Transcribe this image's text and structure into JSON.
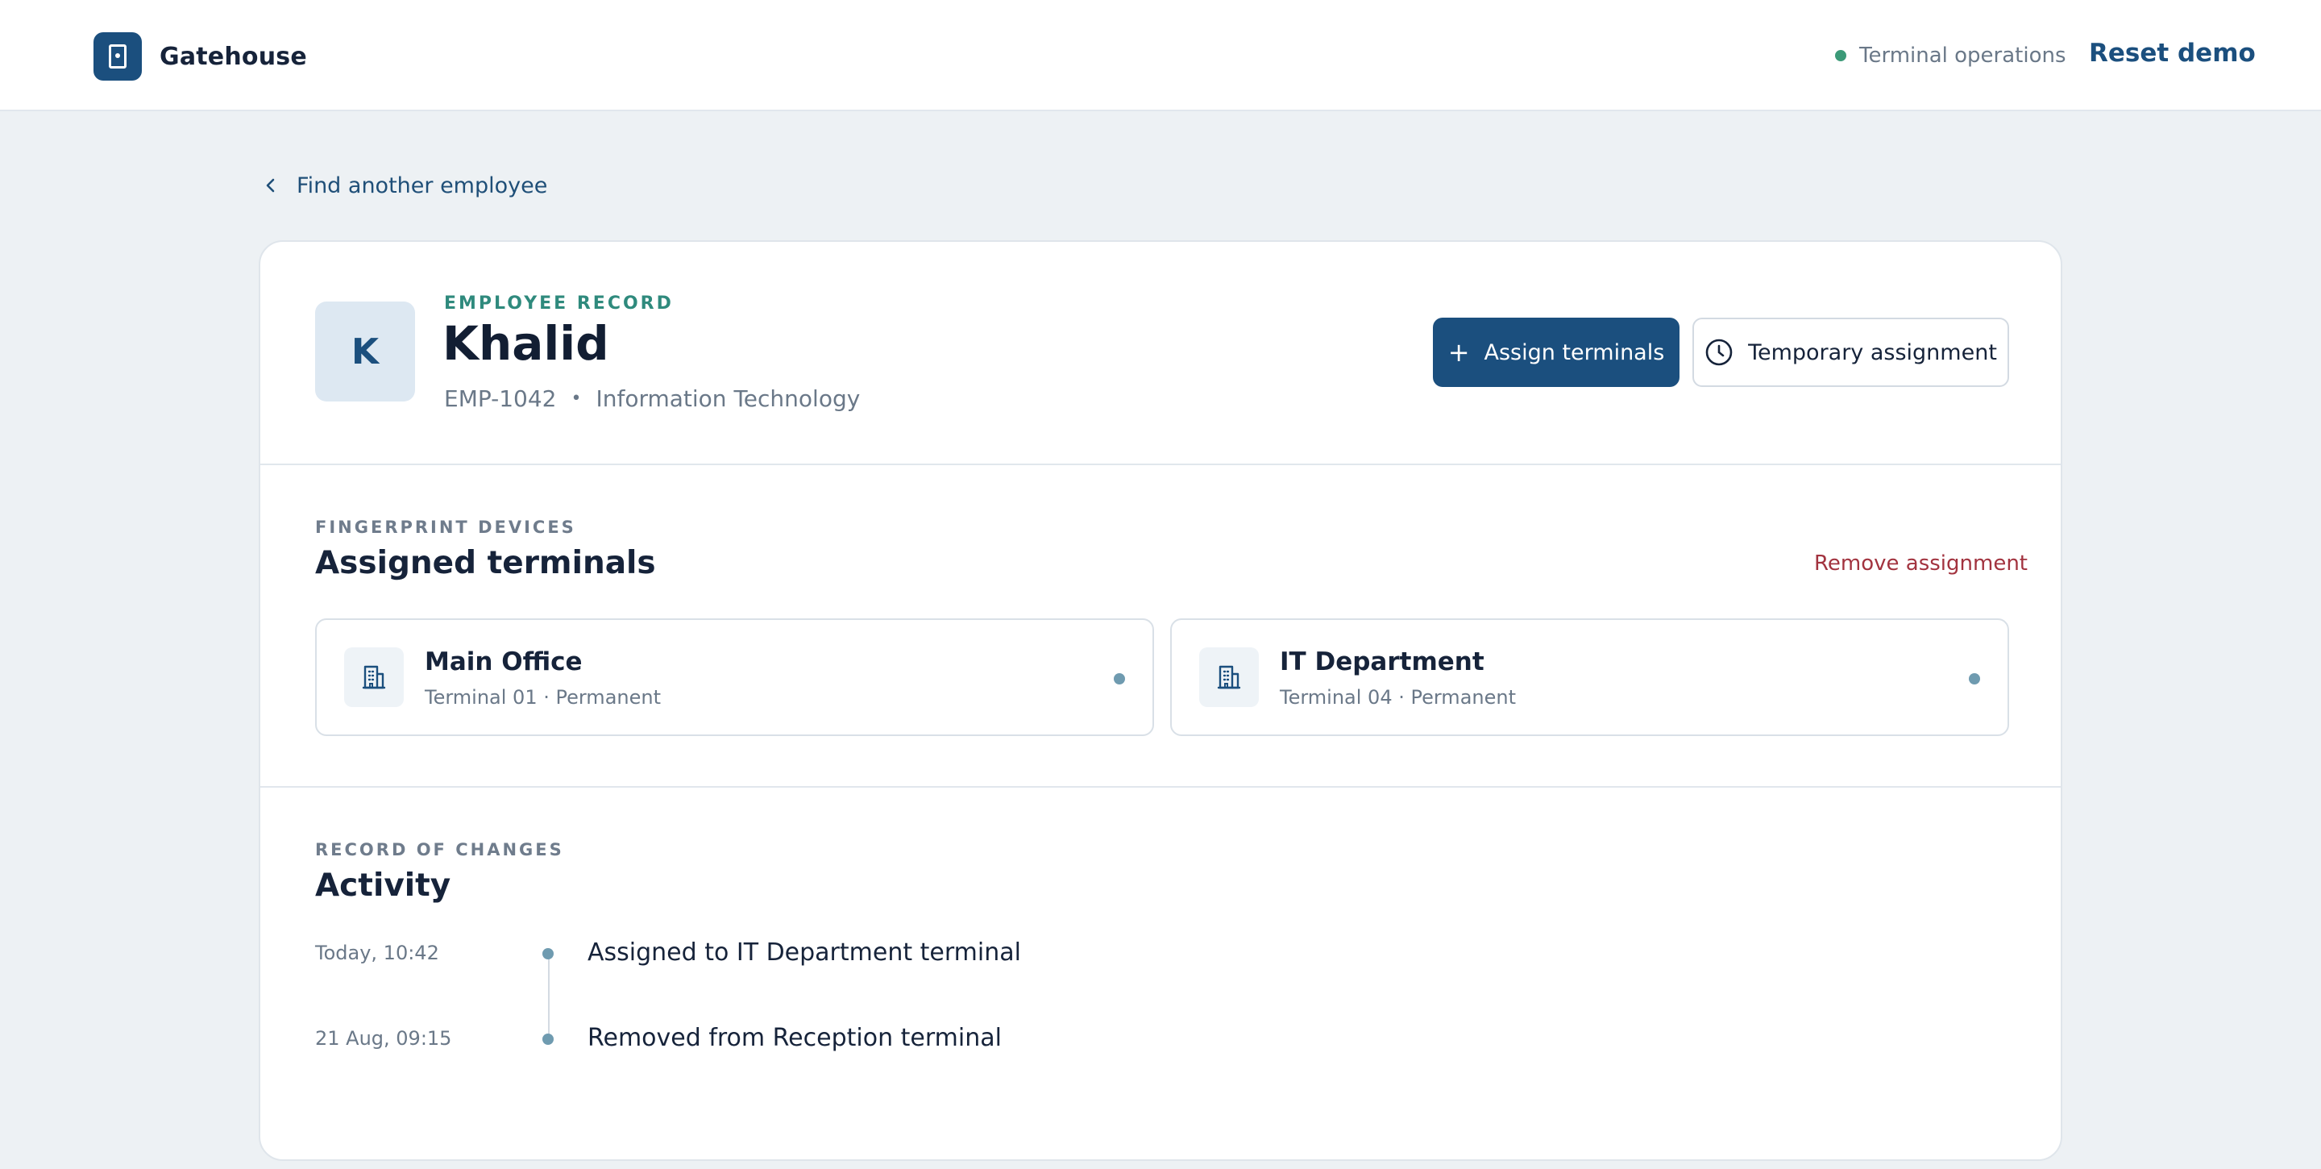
{
  "app": {
    "name": "Gatehouse",
    "logo_icon": "door-icon"
  },
  "header": {
    "status_text": "Terminal operations",
    "status_color": "#3c9a78",
    "reset_label": "Reset demo"
  },
  "back_link": {
    "label": "Find another employee",
    "icon": "chevron-left-icon"
  },
  "employee": {
    "eyebrow": "EMPLOYEE RECORD",
    "initial": "K",
    "name": "Khalid",
    "id": "EMP-1042",
    "separator": "•",
    "department": "Information Technology"
  },
  "actions": {
    "assign_label": "Assign terminals",
    "assign_icon": "plus-icon",
    "temporary_label": "Temporary assignment",
    "temporary_icon": "clock-icon",
    "primary_color": "#1b4f7e"
  },
  "terminals_section": {
    "eyebrow": "FINGERPRINT DEVICES",
    "title": "Assigned terminals",
    "remove_label": "Remove assignment",
    "remove_color": "#a2333f",
    "items": [
      {
        "name": "Main Office",
        "meta": "Terminal 01 · Permanent",
        "icon": "building-icon"
      },
      {
        "name": "IT Department",
        "meta": "Terminal 04 · Permanent",
        "icon": "building-icon"
      }
    ]
  },
  "activity_section": {
    "eyebrow": "RECORD OF CHANGES",
    "title": "Activity",
    "entries": [
      {
        "time": "Today, 10:42",
        "text": "Assigned to IT Department terminal"
      },
      {
        "time": "21 Aug, 09:15",
        "text": "Removed from Reception terminal"
      }
    ]
  }
}
